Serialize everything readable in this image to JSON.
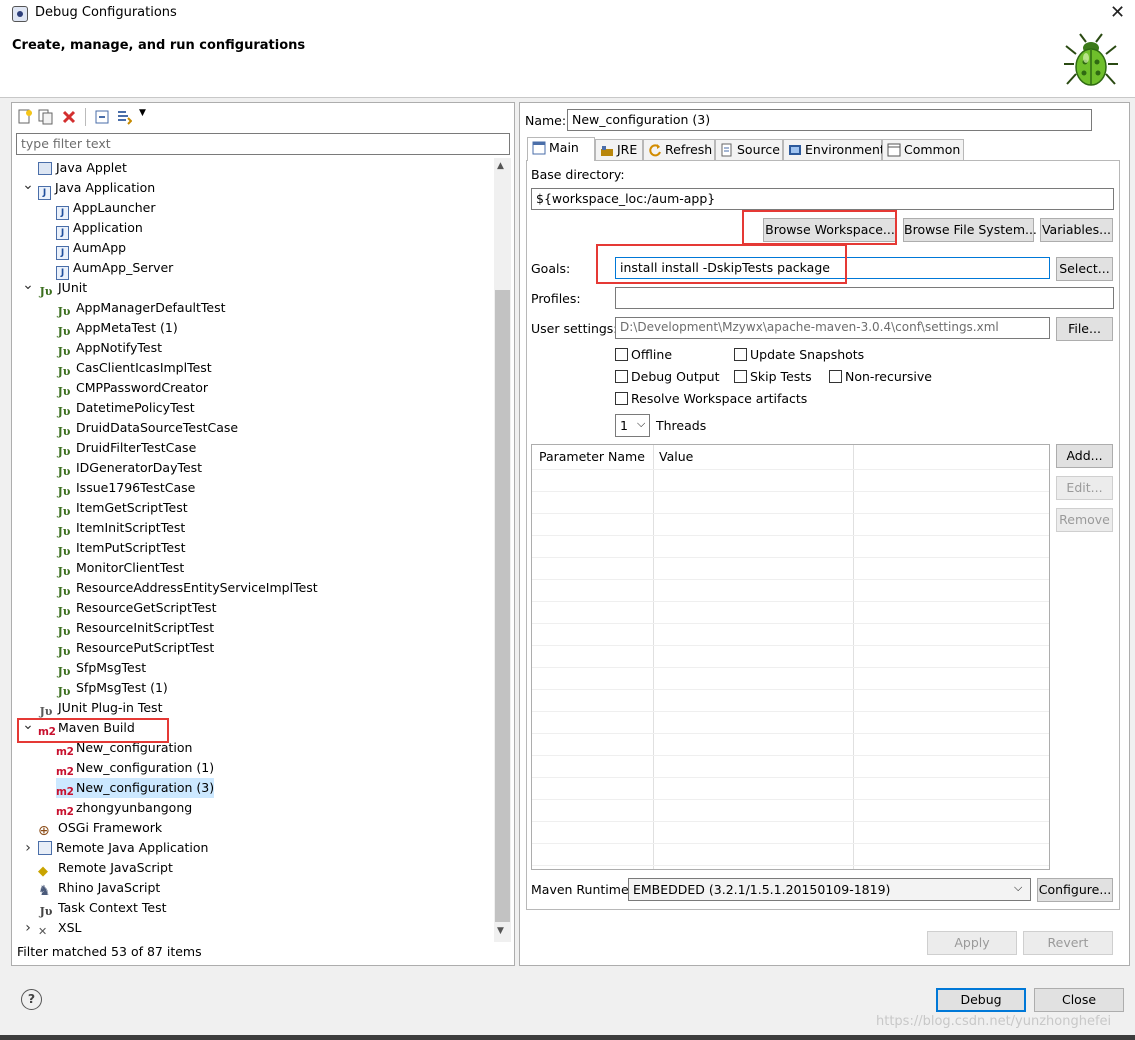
{
  "window": {
    "title": "Debug Configurations"
  },
  "header": {
    "subtitle": "Create, manage, and run configurations"
  },
  "left": {
    "filter_placeholder": "type filter text",
    "tree": [
      {
        "label": "Java Applet",
        "icon": "java-applet-icon"
      },
      {
        "label": "Java Application",
        "icon": "java-application-icon",
        "expanded": true
      },
      {
        "label": "AppLauncher",
        "icon": "java-class-icon"
      },
      {
        "label": "Application",
        "icon": "java-class-icon"
      },
      {
        "label": "AumApp",
        "icon": "java-class-icon"
      },
      {
        "label": "AumApp_Server",
        "icon": "java-class-icon"
      },
      {
        "label": "JUnit",
        "icon": "junit-icon",
        "expanded": true
      },
      {
        "label": "AppManagerDefaultTest",
        "icon": "junit-icon"
      },
      {
        "label": "AppMetaTest (1)",
        "icon": "junit-icon"
      },
      {
        "label": "AppNotifyTest",
        "icon": "junit-icon"
      },
      {
        "label": "CasClientIcasImplTest",
        "icon": "junit-icon"
      },
      {
        "label": "CMPPasswordCreator",
        "icon": "junit-icon"
      },
      {
        "label": "DatetimePolicyTest",
        "icon": "junit-icon"
      },
      {
        "label": "DruidDataSourceTestCase",
        "icon": "junit-icon"
      },
      {
        "label": "DruidFilterTestCase",
        "icon": "junit-icon"
      },
      {
        "label": "IDGeneratorDayTest",
        "icon": "junit-icon"
      },
      {
        "label": "Issue1796TestCase",
        "icon": "junit-icon"
      },
      {
        "label": "ItemGetScriptTest",
        "icon": "junit-icon"
      },
      {
        "label": "ItemInitScriptTest",
        "icon": "junit-icon"
      },
      {
        "label": "ItemPutScriptTest",
        "icon": "junit-icon"
      },
      {
        "label": "MonitorClientTest",
        "icon": "junit-icon"
      },
      {
        "label": "ResourceAddressEntityServiceImplTest",
        "icon": "junit-icon"
      },
      {
        "label": "ResourceGetScriptTest",
        "icon": "junit-icon"
      },
      {
        "label": "ResourceInitScriptTest",
        "icon": "junit-icon"
      },
      {
        "label": "ResourcePutScriptTest",
        "icon": "junit-icon"
      },
      {
        "label": "SfpMsgTest",
        "icon": "junit-icon"
      },
      {
        "label": "SfpMsgTest (1)",
        "icon": "junit-icon"
      },
      {
        "label": "JUnit Plug-in Test",
        "icon": "junit-plugin-icon"
      },
      {
        "label": "Maven Build",
        "icon": "m2-icon",
        "expanded": true
      },
      {
        "label": "New_configuration",
        "icon": "m2-icon"
      },
      {
        "label": "New_configuration (1)",
        "icon": "m2-icon"
      },
      {
        "label": "New_configuration (3)",
        "icon": "m2-icon",
        "selected": true
      },
      {
        "label": "zhongyunbangong",
        "icon": "m2-icon"
      },
      {
        "label": "OSGi Framework",
        "icon": "osgi-icon"
      },
      {
        "label": "Remote Java Application",
        "icon": "remote-java-icon",
        "collapsed": true
      },
      {
        "label": "Remote JavaScript",
        "icon": "remote-js-icon"
      },
      {
        "label": "Rhino JavaScript",
        "icon": "rhino-icon"
      },
      {
        "label": "Task Context Test",
        "icon": "task-context-icon"
      },
      {
        "label": "XSL",
        "icon": "xsl-icon",
        "collapsed": true
      }
    ],
    "status": "Filter matched 53 of 87 items"
  },
  "right": {
    "name_label": "Name:",
    "name_value": "New_configuration (3)",
    "tabs": [
      {
        "label": "Main",
        "icon": "main-tab-icon",
        "active": true
      },
      {
        "label": "JRE",
        "icon": "jre-icon"
      },
      {
        "label": "Refresh",
        "icon": "refresh-icon"
      },
      {
        "label": "Source",
        "icon": "source-icon"
      },
      {
        "label": "Environment",
        "icon": "environment-icon"
      },
      {
        "label": "Common",
        "icon": "common-icon"
      }
    ],
    "base_dir_label": "Base directory:",
    "base_dir_value": "${workspace_loc:/aum-app}",
    "browse_workspace": "Browse Workspace...",
    "browse_fs": "Browse File System...",
    "variables": "Variables...",
    "goals_label": "Goals:",
    "goals_value": "install  install -DskipTests  package",
    "select": "Select...",
    "profiles_label": "Profiles:",
    "profiles_value": "",
    "user_settings_label": "User settings:",
    "user_settings_value": "D:\\Development\\Mzywx\\apache-maven-3.0.4\\conf\\settings.xml",
    "file": "File...",
    "checkboxes": {
      "offline": "Offline",
      "update_snapshots": "Update Snapshots",
      "debug_output": "Debug Output",
      "skip_tests": "Skip Tests",
      "non_recursive": "Non-recursive",
      "resolve_ws": "Resolve Workspace artifacts"
    },
    "threads_value": "1",
    "threads_label": "Threads",
    "param_headers": [
      "Parameter Name",
      "Value"
    ],
    "add": "Add...",
    "edit": "Edit...",
    "remove": "Remove",
    "runtime_label": "Maven Runtime:",
    "runtime_value": "EMBEDDED (3.2.1/1.5.1.20150109-1819)",
    "configure": "Configure...",
    "apply": "Apply",
    "revert": "Revert"
  },
  "footer": {
    "debug": "Debug",
    "close": "Close",
    "watermark": "https://blog.csdn.net/yunzhonghefei"
  },
  "colors": {
    "highlight": "#e53935",
    "selection": "#cce8ff",
    "primary_border": "#0078d7"
  }
}
